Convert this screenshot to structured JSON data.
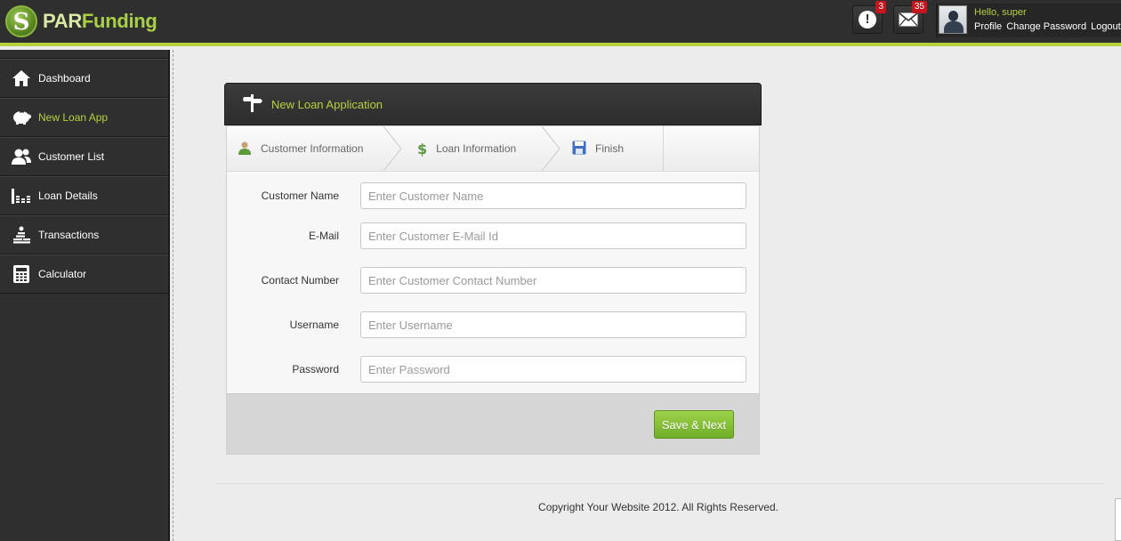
{
  "brand": {
    "name_prefix": "PAR",
    "name_suffix": "Funding",
    "accent_color": "#b3d23c"
  },
  "header": {
    "alerts": {
      "icon": "alert-icon",
      "count": "3"
    },
    "messages": {
      "icon": "mail-icon",
      "count": "35"
    },
    "user": {
      "greeting": "Hello, super",
      "links": {
        "profile": "Profile",
        "change_password": "Change Password",
        "logout": "Logout"
      }
    }
  },
  "sidebar": {
    "items": [
      {
        "label": "Dashboard",
        "icon": "home-icon",
        "active": false
      },
      {
        "label": "New Loan App",
        "icon": "piggy-bank-icon",
        "active": true
      },
      {
        "label": "Customer List",
        "icon": "users-icon",
        "active": false
      },
      {
        "label": "Loan Details",
        "icon": "coins-chart-icon",
        "active": false
      },
      {
        "label": "Transactions",
        "icon": "coin-stack-icon",
        "active": false
      },
      {
        "label": "Calculator",
        "icon": "calculator-icon",
        "active": false
      }
    ]
  },
  "panel": {
    "title": "New Loan Application",
    "title_icon": "signpost-icon",
    "steps": [
      {
        "label": "Customer Information",
        "icon": "user-icon"
      },
      {
        "label": "Loan Information",
        "icon": "dollar-icon"
      },
      {
        "label": "Finish",
        "icon": "floppy-disk-icon"
      }
    ],
    "fields": [
      {
        "label": "Customer Name",
        "placeholder": "Enter Customer Name",
        "value": ""
      },
      {
        "label": "E-Mail",
        "placeholder": "Enter Customer E-Mail Id",
        "value": ""
      },
      {
        "label": "Contact Number",
        "placeholder": "Enter Customer Contact Number",
        "value": ""
      },
      {
        "label": "Username",
        "placeholder": "Enter Username",
        "value": ""
      },
      {
        "label": "Password",
        "placeholder": "Enter Password",
        "value": ""
      }
    ],
    "submit_label": "Save & Next"
  },
  "footer": {
    "copyright": "Copyright Your Website 2012. All Rights Reserved."
  }
}
